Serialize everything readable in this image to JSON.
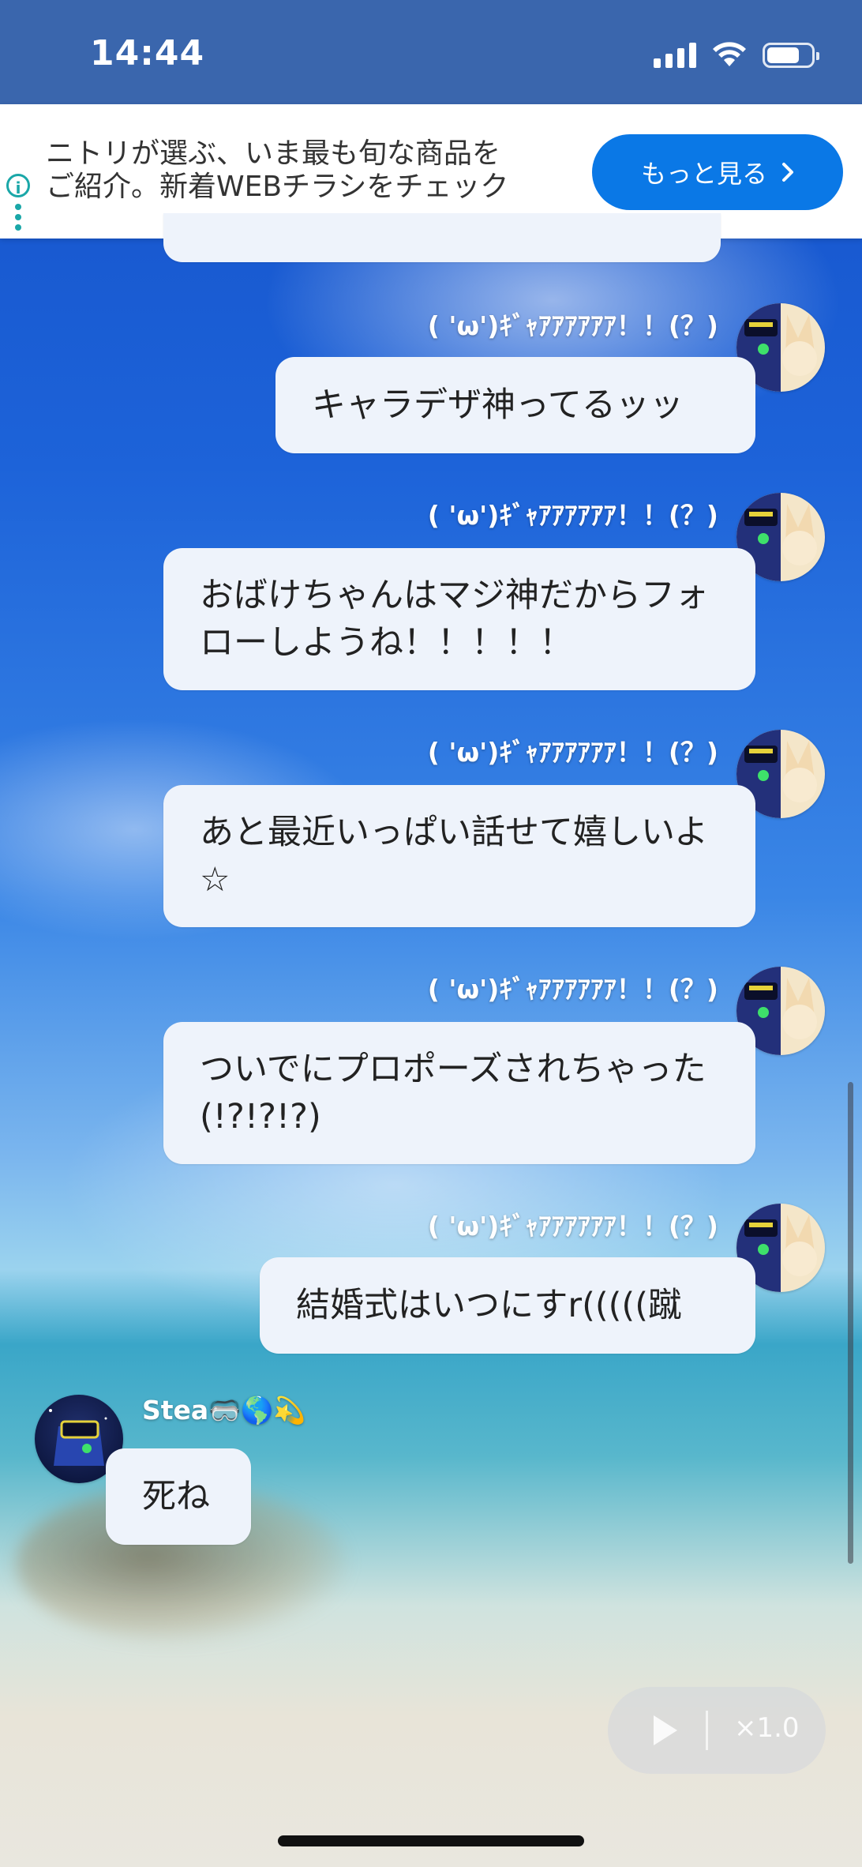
{
  "status_bar": {
    "time": "14:44"
  },
  "ad": {
    "text_line1": "ニトリが選ぶ、いま最も旬な商品を",
    "text_line2": "ご紹介。新着WEBチラシをチェック",
    "button_label": "もっと見る",
    "info_icon": "info-icon"
  },
  "chat": {
    "my_name": "( 'ω')ｷﾞｬｱｱｱｱｱｱ！！(？)",
    "messages": [
      {
        "sender": "me",
        "text": "キャラデザ神ってるッッ"
      },
      {
        "sender": "me",
        "text": "おばけちゃんはマジ神だからフォローしようね！！！！！"
      },
      {
        "sender": "me",
        "text": "あと最近いっぱい話せて嬉しいよ☆"
      },
      {
        "sender": "me",
        "text": "ついでにプロポーズされちゃった(!?!?!?)"
      },
      {
        "sender": "me",
        "text": "結婚式はいつにすr(((((蹴"
      },
      {
        "sender": "other",
        "name": "Stea🥽🌎💫",
        "text": "死ね"
      }
    ]
  },
  "playback": {
    "speed_label": "×1.0"
  },
  "colors": {
    "status_bar_bg": "#3a66ad",
    "ad_button": "#0a78e6",
    "bubble_bg": "#eef3fb",
    "info_accent": "#1aa7a8"
  }
}
